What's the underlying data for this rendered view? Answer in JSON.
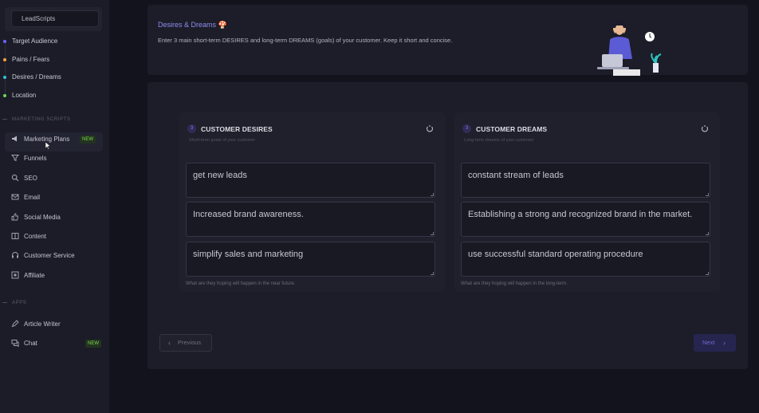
{
  "sidebar": {
    "app_name": "LeadScripts",
    "steps": [
      {
        "label": "Target Audience",
        "color": "#6c63ff"
      },
      {
        "label": "Pains / Fears",
        "color": "#f0a53b"
      },
      {
        "label": "Desires / Dreams",
        "color": "#2ec4d6"
      },
      {
        "label": "Location",
        "color": "#6cd65a"
      }
    ],
    "section_marketing": "MARKETING SCRIPTS",
    "marketing_items": [
      {
        "label": "Marketing Plans",
        "icon": "megaphone-icon",
        "badge": "NEW"
      },
      {
        "label": "Funnels",
        "icon": "funnel-icon"
      },
      {
        "label": "SEO",
        "icon": "search-icon"
      },
      {
        "label": "Email",
        "icon": "mail-icon"
      },
      {
        "label": "Social Media",
        "icon": "thumbs-up-icon"
      },
      {
        "label": "Content",
        "icon": "book-icon"
      },
      {
        "label": "Customer Service",
        "icon": "headset-icon"
      },
      {
        "label": "Affiliate",
        "icon": "affiliate-icon"
      }
    ],
    "section_apps": "APPS",
    "app_items": [
      {
        "label": "Article Writer",
        "icon": "pen-icon"
      },
      {
        "label": "Chat",
        "icon": "chat-icon",
        "badge": "NEW"
      }
    ]
  },
  "header": {
    "title": "Desires & Dreams 🍄",
    "description": "Enter 3 main short-term DESIRES and long-term DREAMS (goals) of your customer. Keep it short and concise."
  },
  "desires": {
    "number": "3",
    "title": "CUSTOMER DESIRES",
    "subtitle": "Short-term goals of your customer",
    "values": [
      "get new leads",
      "Increased brand awareness.",
      "simplify sales and marketing"
    ],
    "footer": "What are they hoping will happen in the near future."
  },
  "dreams": {
    "number": "3",
    "title": "CUSTOMER DREAMS",
    "subtitle": "Long-term dreams of your customer",
    "values": [
      "constant stream of leads",
      "Establishing a strong and recognized brand in the market.",
      "use successful standard operating procedure"
    ],
    "footer": "What are they hoping will happen in the long-term."
  },
  "nav": {
    "previous_label": "Previous",
    "next_label": "Next"
  },
  "colors": {
    "accent": "#8f8cf0",
    "badge_green": "#7ed957"
  }
}
